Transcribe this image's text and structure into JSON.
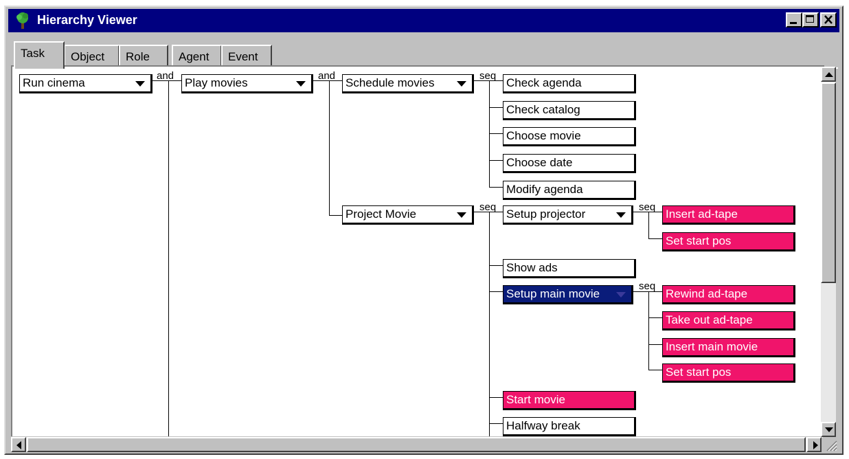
{
  "window": {
    "title": "Hierarchy Viewer"
  },
  "tabs": [
    {
      "label": "Task"
    },
    {
      "label": "Object"
    },
    {
      "label": "Role"
    },
    {
      "label": "Agent"
    },
    {
      "label": "Event"
    }
  ],
  "operators": {
    "and1": "and",
    "and2": "and",
    "seq1": "seq",
    "seq2": "seq",
    "seq3": "seq",
    "seq4": "seq"
  },
  "tasks": {
    "run_cinema": "Run cinema",
    "play_movies": "Play movies",
    "schedule_movies": "Schedule movies",
    "check_agenda": "Check agenda",
    "check_catalog": "Check catalog",
    "choose_movie": "Choose movie",
    "choose_date": "Choose date",
    "modify_agenda": "Modify agenda",
    "project_movie": "Project Movie",
    "setup_projector": "Setup projector",
    "insert_ad_tape": "Insert ad-tape",
    "set_start_pos_1": "Set start pos",
    "show_ads": "Show ads",
    "setup_main_movie": "Setup main movie",
    "rewind_ad_tape": "Rewind ad-tape",
    "take_out_ad_tape": "Take out ad-tape",
    "insert_main_movie": "Insert main movie",
    "set_start_pos_2": "Set start pos",
    "start_movie": "Start movie",
    "halfway_break": "Halfway break"
  },
  "colors": {
    "titlebar": "#000080",
    "highlight_task": "#f0146b",
    "selected_task": "#0a1c7a"
  }
}
